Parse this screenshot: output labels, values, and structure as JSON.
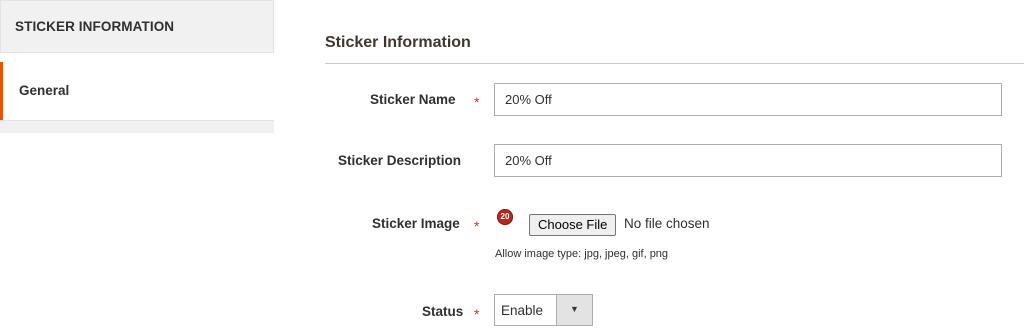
{
  "sidebar": {
    "header": "STICKER INFORMATION",
    "items": [
      {
        "label": "General",
        "active": true
      }
    ]
  },
  "section": {
    "title": "Sticker Information"
  },
  "form": {
    "sticker_name": {
      "label": "Sticker Name",
      "value": "20% Off",
      "required": true
    },
    "sticker_description": {
      "label": "Sticker Description",
      "value": "20% Off",
      "required": false
    },
    "sticker_image": {
      "label": "Sticker Image",
      "required": true,
      "badge": "20",
      "button_label": "Choose File",
      "status_text": "No file chosen",
      "note": "Allow image type: jpg, jpeg, gif, png"
    },
    "status": {
      "label": "Status",
      "value": "Enable",
      "required": true
    }
  },
  "colors": {
    "accent": "#eb5202",
    "required": "#e22626",
    "badge": "#b52a1c"
  },
  "icons": {
    "required": "asterisk",
    "select_toggle": "caret-down"
  }
}
